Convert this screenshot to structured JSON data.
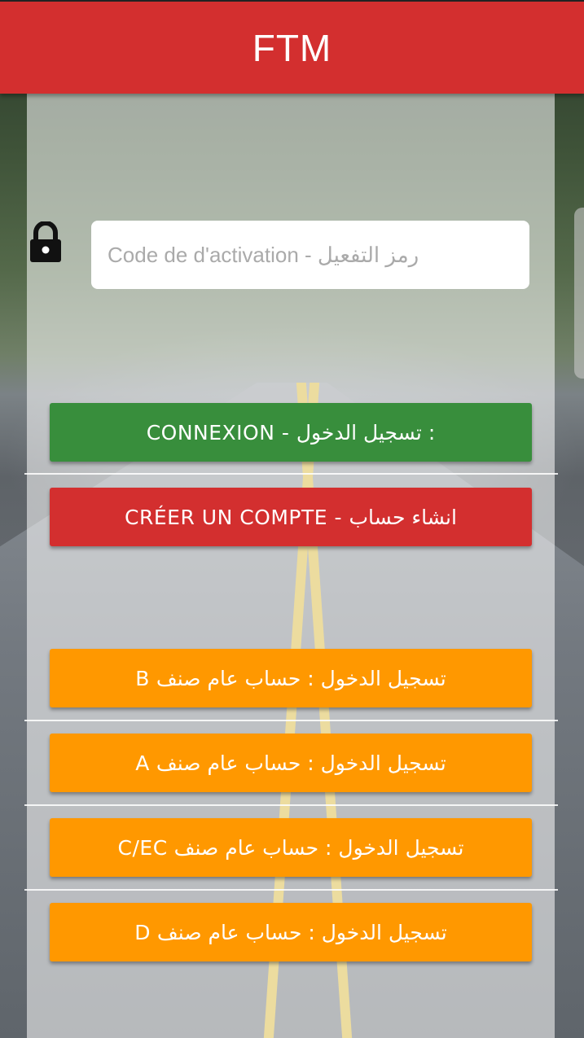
{
  "app": {
    "title": "FTM"
  },
  "activation": {
    "placeholder": "Code de d'activation - رمز التفعيل",
    "value": ""
  },
  "buttons": {
    "connexion": "CONNEXION - تسجيل الدخول :",
    "create_account": "CRÉER UN COMPTE - انشاء حساب",
    "category_b": "تسجيل الدخول : حساب عام صنف B",
    "category_a": "تسجيل الدخول : حساب عام صنف A",
    "category_cec": "تسجيل الدخول : حساب عام صنف C/EC",
    "category_d": "تسجيل الدخول : حساب عام صنف D"
  },
  "icons": {
    "lock": "lock-icon"
  },
  "colors": {
    "appbar": "#d32f2f",
    "connexion": "#388e3c",
    "create_account": "#d32f2f",
    "category": "#ff9800"
  }
}
